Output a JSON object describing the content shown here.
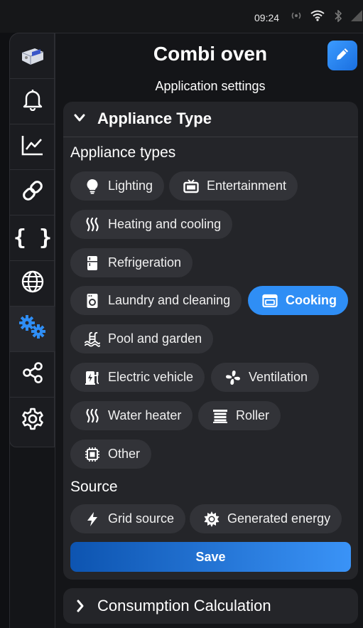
{
  "status_bar": {
    "time": "09:24"
  },
  "header": {
    "title": "Combi oven",
    "subtitle": "Application settings"
  },
  "rail": {
    "items": [
      {
        "name": "device-thumbnail"
      },
      {
        "name": "bell-icon"
      },
      {
        "name": "chart-icon"
      },
      {
        "name": "link-icon"
      },
      {
        "name": "braces-icon"
      },
      {
        "name": "globe-icon"
      },
      {
        "name": "cogs-icon",
        "active": true
      },
      {
        "name": "share-icon"
      },
      {
        "name": "settings-icon"
      }
    ]
  },
  "panel": {
    "title": "Appliance Type",
    "appliance_types_label": "Appliance types",
    "appliance_types": [
      {
        "label": "Lighting",
        "icon": "lightbulb-icon"
      },
      {
        "label": "Entertainment",
        "icon": "tv-icon"
      },
      {
        "label": "Heating and cooling",
        "icon": "heat-waves-icon"
      },
      {
        "label": "Refrigeration",
        "icon": "fridge-icon"
      },
      {
        "label": "Laundry and cleaning",
        "icon": "washer-icon"
      },
      {
        "label": "Cooking",
        "icon": "oven-icon",
        "selected": true
      },
      {
        "label": "Pool and garden",
        "icon": "pool-icon"
      },
      {
        "label": "Electric vehicle",
        "icon": "ev-charger-icon"
      },
      {
        "label": "Ventilation",
        "icon": "fan-icon"
      },
      {
        "label": "Water heater",
        "icon": "heat-waves-icon"
      },
      {
        "label": "Roller",
        "icon": "shutter-icon"
      },
      {
        "label": "Other",
        "icon": "chip-icon"
      }
    ],
    "source_label": "Source",
    "sources": [
      {
        "label": "Grid source",
        "icon": "bolt-icon"
      },
      {
        "label": "Generated energy",
        "icon": "sun-icon"
      }
    ],
    "save_label": "Save"
  },
  "panel2": {
    "title": "Consumption Calculation"
  },
  "colors": {
    "accent": "#2f8ef5",
    "panel": "#242529",
    "chip": "#323338",
    "background": "#0f1013"
  }
}
